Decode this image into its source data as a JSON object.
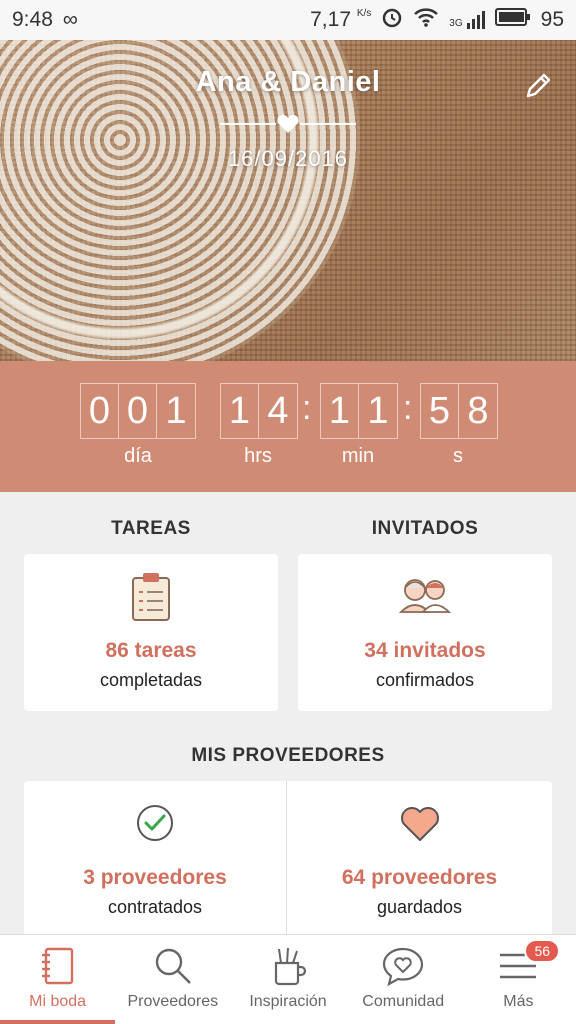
{
  "status_bar": {
    "time": "9:48",
    "speed": "7,17",
    "speed_unit": "K/s",
    "network": "3G",
    "battery": "95"
  },
  "hero": {
    "couple": "Ana & Daniel",
    "date": "16/09/2016"
  },
  "countdown": {
    "days": [
      "0",
      "0",
      "1"
    ],
    "hours": [
      "1",
      "4"
    ],
    "minutes": [
      "1",
      "1"
    ],
    "seconds": [
      "5",
      "8"
    ],
    "labels": {
      "days": "día",
      "hours": "hrs",
      "minutes": "min",
      "seconds": "s"
    }
  },
  "tareas": {
    "title": "TAREAS",
    "count": "86 tareas",
    "sub": "completadas",
    "icon": "clipboard-checklist-icon"
  },
  "invitados": {
    "title": "INVITADOS",
    "count": "34 invitados",
    "sub": "confirmados",
    "icon": "guests-couple-icon"
  },
  "proveedores": {
    "title": "MIS PROVEEDORES",
    "contratados": {
      "count": "3 proveedores",
      "sub": "contratados",
      "icon": "check-circle-icon"
    },
    "guardados": {
      "count": "64 proveedores",
      "sub": "guardados",
      "icon": "heart-icon"
    }
  },
  "nav": {
    "items": [
      {
        "label": "Mi boda",
        "icon": "notebook-icon",
        "active": true
      },
      {
        "label": "Proveedores",
        "icon": "search-icon"
      },
      {
        "label": "Inspiración",
        "icon": "pencil-cup-icon"
      },
      {
        "label": "Comunidad",
        "icon": "chat-heart-icon"
      },
      {
        "label": "Más",
        "icon": "menu-icon",
        "badge": "56"
      }
    ]
  },
  "colors": {
    "accent": "#d1705f",
    "countdown_bg": "#d08b74",
    "check": "#3aa54a",
    "heart": "#f4a88c"
  }
}
